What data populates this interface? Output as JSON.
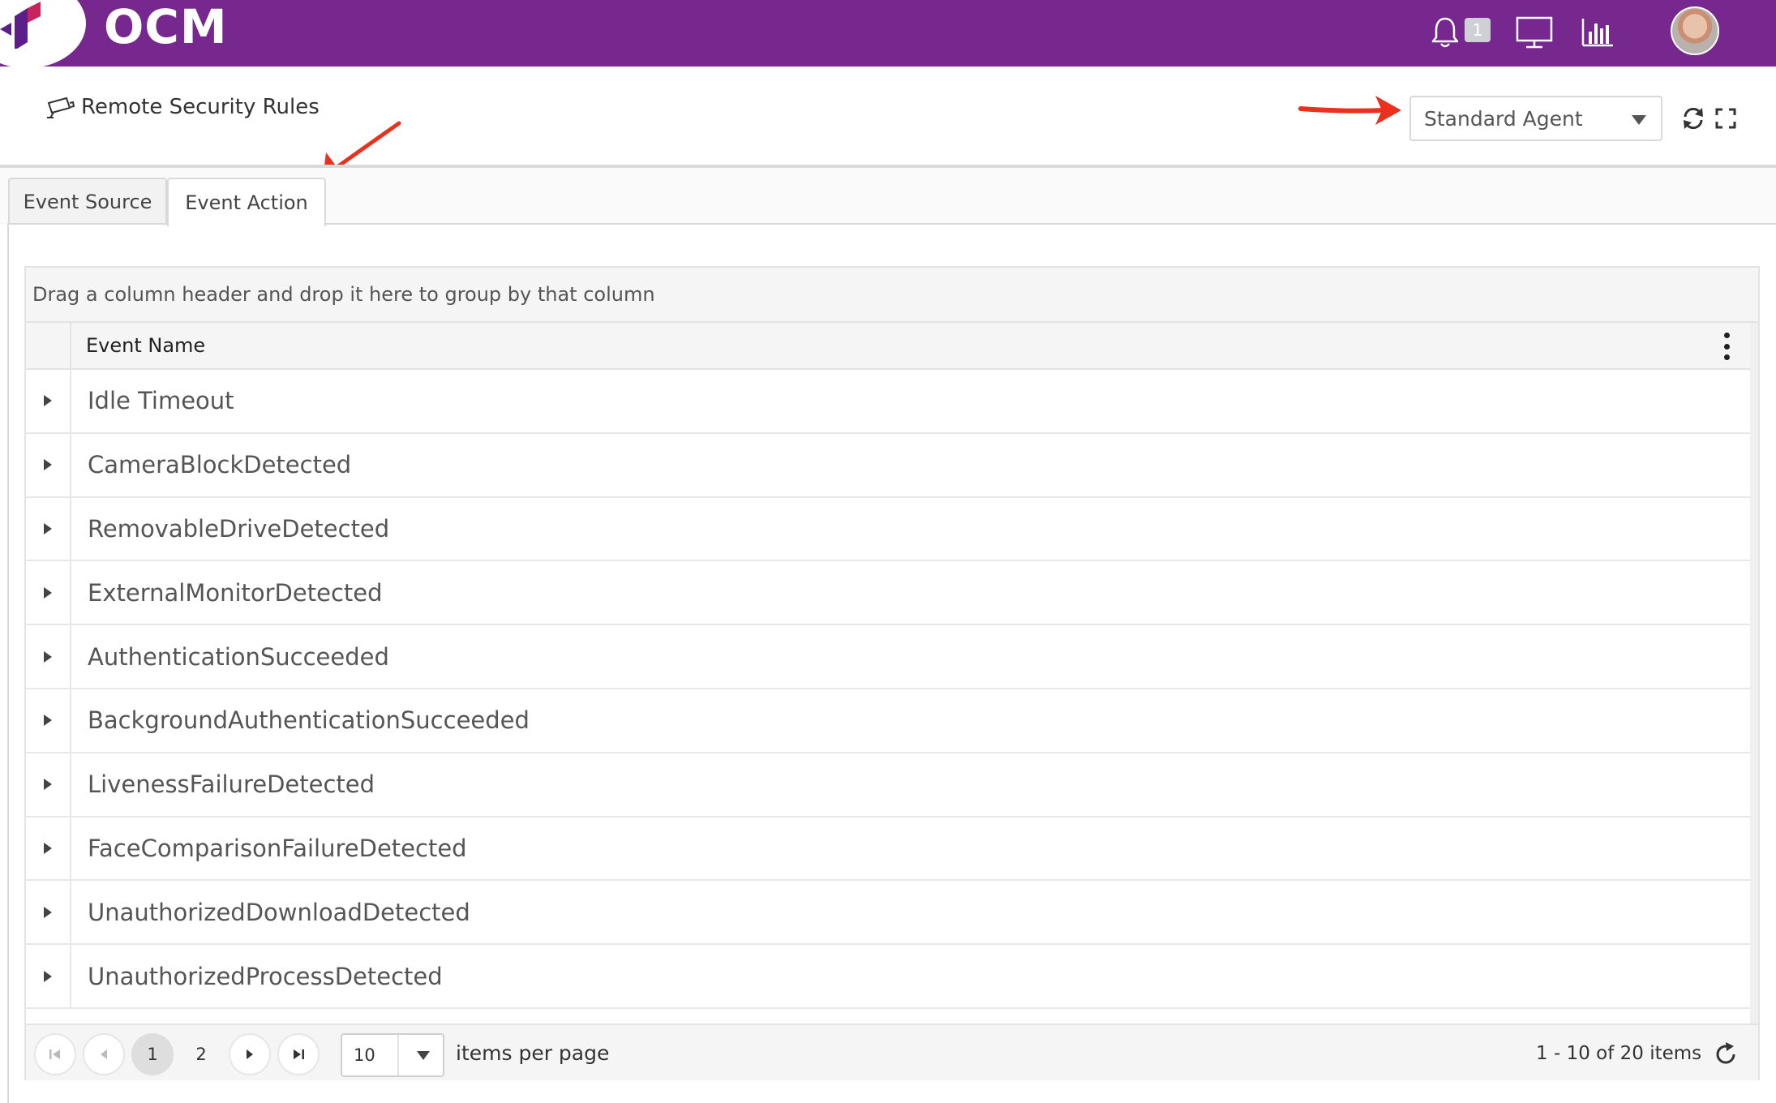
{
  "app": {
    "brand": "OCM",
    "notification_count": "1",
    "colors": {
      "header": "#76288f",
      "logo_accent": "#c8235f",
      "logo_dark": "#5b1f87",
      "annotation": "#e8321e"
    }
  },
  "header_icons": [
    "bell-icon",
    "monitor-icon",
    "bar-chart-icon",
    "avatar"
  ],
  "page": {
    "title": "Remote Security Rules",
    "title_icon": "camera-icon",
    "agent_select": {
      "value": "Standard Agent"
    },
    "actions": [
      "refresh-icon",
      "fullscreen-icon"
    ]
  },
  "tabs": [
    {
      "label": "Event Source",
      "active": false
    },
    {
      "label": "Event Action",
      "active": true
    }
  ],
  "grid": {
    "group_hint": "Drag a column header and drop it here to group by that column",
    "column_header": "Event Name",
    "rows": [
      "Idle Timeout",
      "CameraBlockDetected",
      "RemovableDriveDetected",
      "ExternalMonitorDetected",
      "AuthenticationSucceeded",
      "BackgroundAuthenticationSucceeded",
      "LivenessFailureDetected",
      "FaceComparisonFailureDetected",
      "UnauthorizedDownloadDetected",
      "UnauthorizedProcessDetected"
    ]
  },
  "pager": {
    "pages": [
      "1",
      "2"
    ],
    "current_page": "1",
    "page_size": "10",
    "items_per_page_label": "items per page",
    "info": "1 - 10 of 20 items"
  }
}
